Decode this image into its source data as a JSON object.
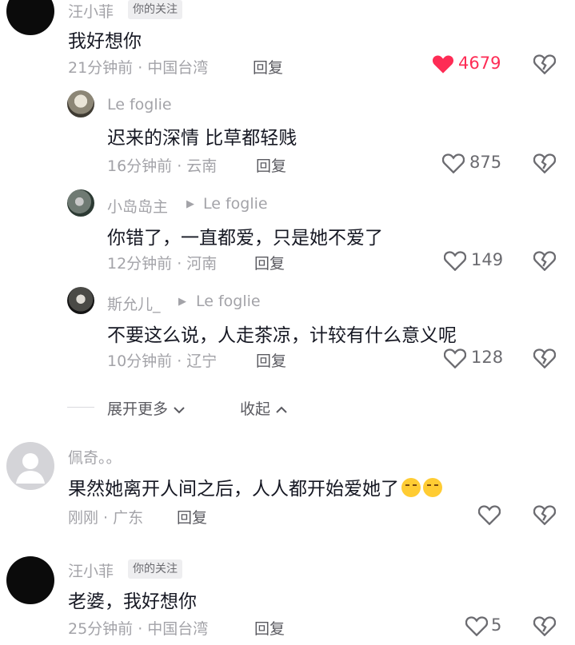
{
  "comments": [
    {
      "user": "汪小菲",
      "badge": "你的关注",
      "text": "我好想你",
      "time": "21分钟前 · 中国台湾",
      "reply_label": "回复",
      "likes": "4679",
      "liked": true,
      "replies": [
        {
          "user": "Le foglie",
          "text": "迟来的深情 比草都轻贱",
          "time": "16分钟前 · 云南",
          "reply_label": "回复",
          "likes": "875"
        },
        {
          "user": "小岛岛主",
          "reply_to": "Le foglie",
          "text": "你错了，一直都爱，只是她不爱了",
          "time": "12分钟前 · 河南",
          "reply_label": "回复",
          "likes": "149"
        },
        {
          "user": "斯允儿_",
          "reply_to": "Le foglie",
          "text": "不要这么说，人走茶凉，计较有什么意义呢",
          "time": "10分钟前 · 辽宁",
          "reply_label": "回复",
          "likes": "128"
        }
      ],
      "expand_more": "展开更多",
      "collapse": "收起"
    },
    {
      "user": "佩奇。。",
      "text": "果然她离开人间之后，人人都开始爱她了",
      "emoji": [
        "loudly-crying-face",
        "loudly-crying-face"
      ],
      "time": "刚刚 · 广东",
      "reply_label": "回复",
      "likes": ""
    },
    {
      "user": "汪小菲",
      "badge": "你的关注",
      "text": "老婆，我好想你",
      "time": "25分钟前 · 中国台湾",
      "reply_label": "回复",
      "likes": "5"
    }
  ],
  "colors": {
    "liked": "#fe2c55",
    "secondary": "#a3a3a8",
    "text": "#161823"
  },
  "icons": [
    "heart-icon",
    "broken-heart-icon",
    "play-triangle-icon",
    "chevron-down-icon",
    "chevron-up-icon",
    "default-avatar-icon"
  ]
}
